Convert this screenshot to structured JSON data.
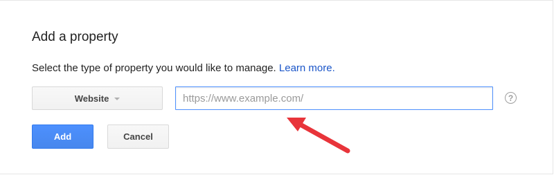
{
  "dialog": {
    "title": "Add a property",
    "prompt": "Select the type of property you would like to manage.",
    "learn_more": "Learn more."
  },
  "property_type": {
    "selected": "Website"
  },
  "url_field": {
    "value": "",
    "placeholder": "https://www.example.com/"
  },
  "help": {
    "glyph": "?"
  },
  "actions": {
    "add_label": "Add",
    "cancel_label": "Cancel"
  },
  "colors": {
    "primary": "#4d90fe",
    "link": "#1a55c8",
    "annotation_arrow": "#e8343a"
  },
  "icons": {
    "dropdown": "caret-down-icon",
    "help": "question-circle-icon",
    "annotation": "red-arrow-icon"
  }
}
